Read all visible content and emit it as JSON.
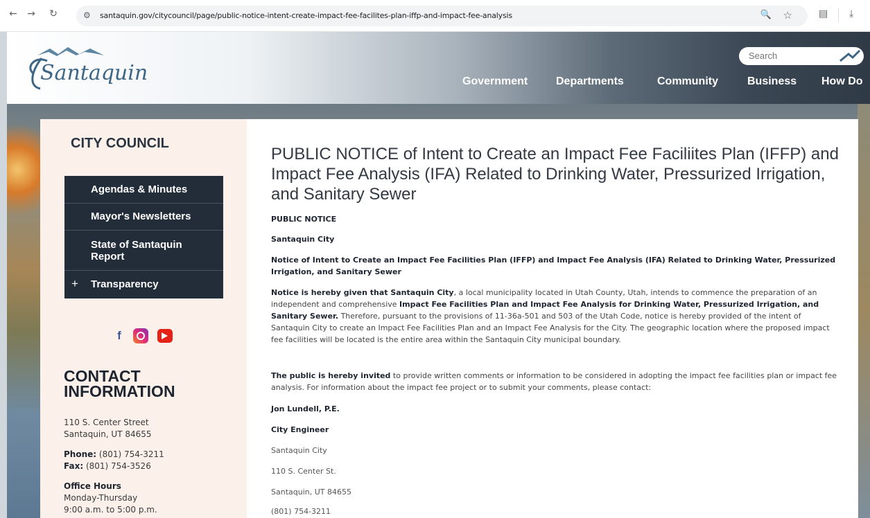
{
  "browser": {
    "url": "santaquin.gov/citycouncil/page/public-notice-intent-create-impact-fee-facilites-plan-iffp-and-impact-fee-analysis"
  },
  "header": {
    "logo_text": "Santaquin",
    "search_placeholder": "Search",
    "nav": [
      "Government",
      "Departments",
      "Community",
      "Business",
      "How Do"
    ]
  },
  "sidebar": {
    "title": "CITY COUNCIL",
    "items": [
      {
        "label": "Agendas & Minutes"
      },
      {
        "label": "Mayor's Newsletters"
      },
      {
        "label": "State of Santaquin Report"
      },
      {
        "label": "Transparency",
        "prefix": "+"
      }
    ]
  },
  "social": {
    "facebook": "f"
  },
  "contact": {
    "heading_line1": "CONTACT",
    "heading_line2": "INFORMATION",
    "address1": "110 S. Center Street",
    "address2": "Santaquin, UT 84655",
    "phone_label": "Phone:",
    "phone": "(801) 754-3211",
    "fax_label": "Fax:",
    "fax": "(801) 754-3526",
    "hours_label": "Office Hours",
    "hours_days": "Monday-Thursday",
    "hours_time": "9:00 a.m. to 5:00 p.m."
  },
  "article": {
    "title": "PUBLIC NOTICE of Intent to Create an Impact Fee Faciliites Plan (IFFP) and Impact Fee Analysis (IFA) Related to Drinking Water, Pressurized Irrigation, and Sanitary Sewer",
    "p1": "PUBLIC NOTICE",
    "p2": "Santaquin City",
    "p3": "Notice of Intent to Create an Impact Fee Facilities Plan (IFFP) and Impact Fee Analysis (IFA) Related to Drinking Water, Pressurized Irrigation, and Sanitary Sewer",
    "p4_bold1": "Notice is hereby given that Santaquin City",
    "p4_text1": ", a local municipality located in Utah County, Utah, intends to commence the preparation of an independent and comprehensive ",
    "p4_bold2": "Impact Fee Facilities Plan and Impact Fee Analysis for Drinking Water, Pressurized Irrigation, and Sanitary Sewer.",
    "p4_text2": " Therefore, pursuant to the provisions of 11-36a-501 and 503 of the Utah Code, notice is hereby provided of the intent of Santaquin City to create an Impact Fee Facilities Plan and an Impact Fee Analysis for the City. The geographic location where the proposed impact fee facilities will be located is the entire area within the Santaquin City municipal boundary.",
    "p5_bold": "The public is hereby invited",
    "p5_text": " to provide written comments or information to be considered in adopting the impact fee facilities plan or impact fee analysis. For information about the impact fee project or to submit your comments, please contact:",
    "contact_name": "Jon Lundell, P.E.",
    "contact_title": "City Engineer",
    "contact_org": "Santaquin City",
    "contact_street": "110 S. Center St.",
    "contact_city": "Santaquin, UT 84655",
    "contact_phone": "(801) 754-3211"
  }
}
